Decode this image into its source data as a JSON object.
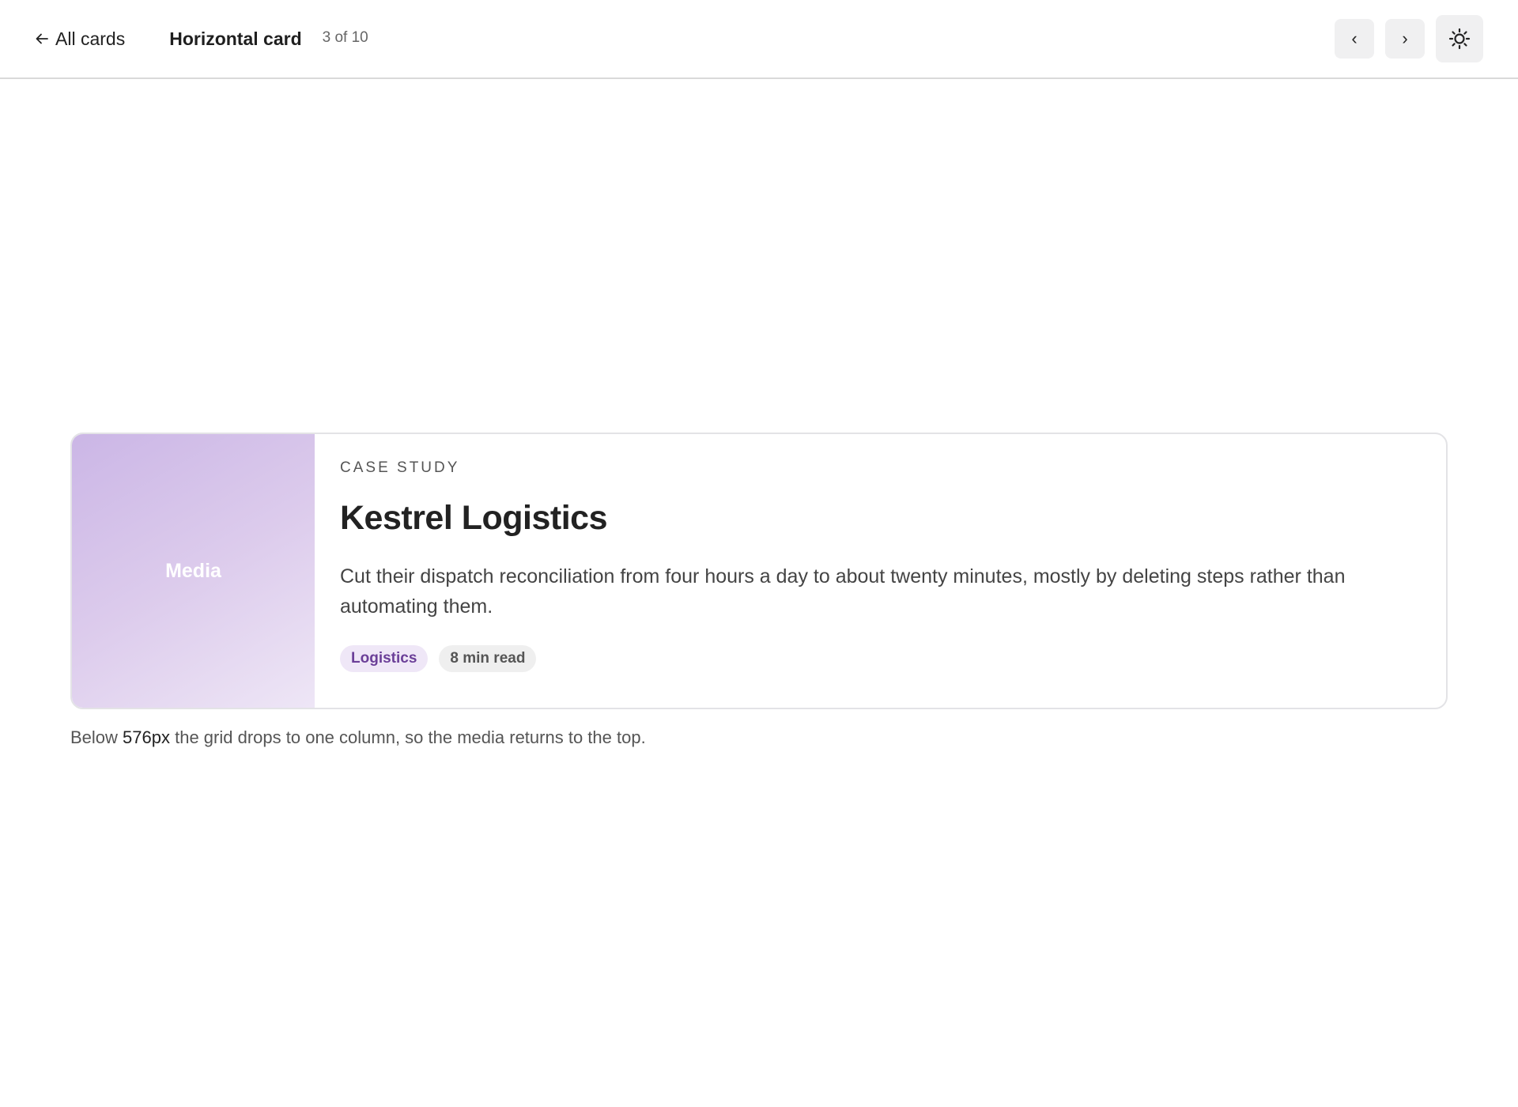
{
  "header": {
    "back_label": "All cards",
    "title": "Horizontal card",
    "count": "3 of 10",
    "prev_label": "‹",
    "next_label": "›"
  },
  "card": {
    "media_label": "Media",
    "eyebrow": "CASE STUDY",
    "title": "Kestrel Logistics",
    "description": "Cut their dispatch reconciliation from four hours a day to about twenty minutes, mostly by deleting steps rather than automating them.",
    "tags": [
      {
        "label": "Logistics"
      },
      {
        "label": "8 min read"
      }
    ],
    "colors": {
      "media_gradient_start": "#cbb6e6",
      "media_gradient_end": "#eee6f6",
      "category_tag_bg": "#efe7f7",
      "category_tag_text": "#6b3f98"
    }
  },
  "caption": {
    "before": "Below ",
    "code": "576px",
    "after": " the grid drops to one column, so the media returns to the top."
  },
  "icons": {
    "back": "arrow-left-icon",
    "theme": "sun-icon"
  }
}
